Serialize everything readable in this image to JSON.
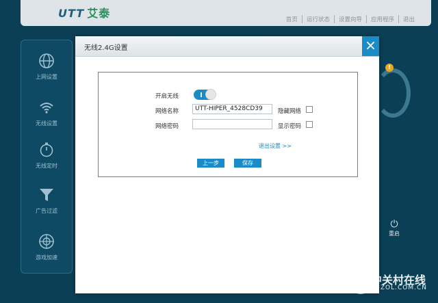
{
  "brand": {
    "logo_latin": "UTT",
    "logo_cn": "艾泰"
  },
  "top_nav": [
    "首页",
    "运行状态",
    "设置向导",
    "应用程序",
    "退出"
  ],
  "sidebar": {
    "items": [
      {
        "label": "上网设置",
        "icon": "globe-icon"
      },
      {
        "label": "无线设置",
        "icon": "wifi-icon"
      },
      {
        "label": "无线定时",
        "icon": "stopwatch-icon"
      },
      {
        "label": "广告过滤",
        "icon": "funnel-icon"
      },
      {
        "label": "游戏加速",
        "icon": "crosshair-icon"
      }
    ]
  },
  "background": {
    "warning_badge": "!",
    "reboot_label": "重启"
  },
  "dialog": {
    "title": "无线2.4G设置",
    "close_symbol": "×",
    "wireless_label": "开启无线",
    "wireless_on": true,
    "ssid_label": "网络名称",
    "ssid_value": "UTT-HIPER_4528CD39",
    "hide_ssid_label": "隐藏网络",
    "password_label": "网络密码",
    "password_value": "",
    "show_password_label": "显示密码",
    "exit_link": "退出设置 >>",
    "prev_button": "上一步",
    "save_button": "保存"
  },
  "watermark": {
    "text": "中关村在线",
    "sub": "ZOL.COM.CN"
  },
  "colors": {
    "accent": "#1a8bc7",
    "background": "#0b3f55"
  }
}
